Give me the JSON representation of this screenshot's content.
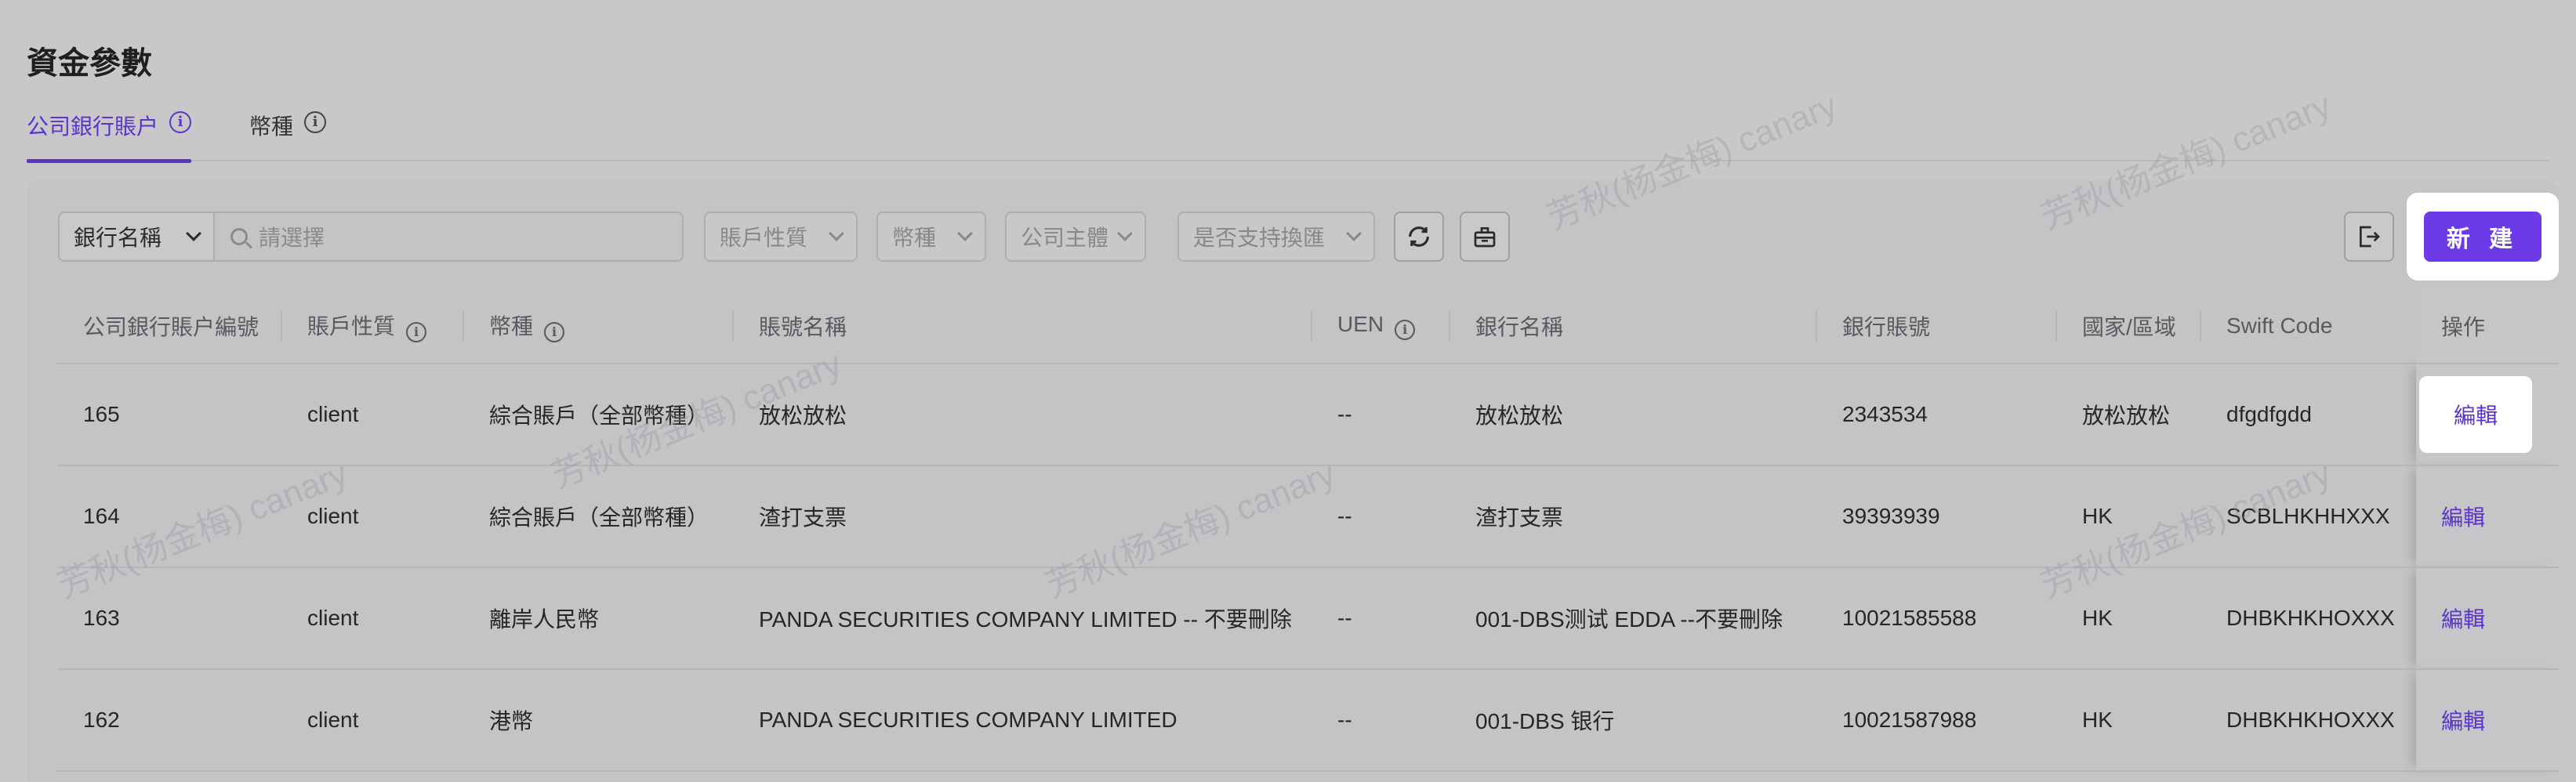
{
  "page": {
    "title": "資金參數"
  },
  "tabs": [
    {
      "label": "公司銀行賬户",
      "active": true
    },
    {
      "label": "幣種",
      "active": false
    }
  ],
  "toolbar": {
    "bank_name_select": "銀行名稱",
    "search_placeholder": "請選擇",
    "account_type_select": "賬戶性質",
    "currency_select": "幣種",
    "entity_select": "公司主體",
    "exchange_select": "是否支持換匯",
    "new_button": "新 建"
  },
  "table": {
    "headers": {
      "id": "公司銀行賬户編號",
      "account_type": "賬戶性質",
      "currency": "幣種",
      "account_name": "賬號名稱",
      "uen": "UEN",
      "bank_name": "銀行名稱",
      "bank_account": "銀行賬號",
      "region": "國家/區域",
      "swift": "Swift Code",
      "action": "操作"
    },
    "rows": [
      {
        "id": "165",
        "account_type": "client",
        "currency": "綜合賬戶（全部幣種）",
        "account_name": "放松放松",
        "uen": "--",
        "bank_name": "放松放松",
        "bank_account": "2343534",
        "region": "放松放松",
        "swift": "dfgdfgdd",
        "action": "編輯"
      },
      {
        "id": "164",
        "account_type": "client",
        "currency": "綜合賬戶（全部幣種）",
        "account_name": "渣打支票",
        "uen": "--",
        "bank_name": "渣打支票",
        "bank_account": "39393939",
        "region": "HK",
        "swift": "SCBLHKHHXXX",
        "action": "編輯"
      },
      {
        "id": "163",
        "account_type": "client",
        "currency": "離岸人民幣",
        "account_name": "PANDA SECURITIES COMPANY LIMITED -- 不要刪除",
        "uen": "--",
        "bank_name": "001-DBS测试 EDDA --不要刪除",
        "bank_account": "10021585588",
        "region": "HK",
        "swift": "DHBKHKHOXXX",
        "action": "編輯"
      },
      {
        "id": "162",
        "account_type": "client",
        "currency": "港幣",
        "account_name": "PANDA SECURITIES COMPANY LIMITED",
        "uen": "--",
        "bank_name": "001-DBS 银行",
        "bank_account": "10021587988",
        "region": "HK",
        "swift": "DHBKHKHOXXX",
        "action": "編輯"
      }
    ]
  },
  "colors": {
    "accent": "#5b35c9",
    "button": "#6c3ae6",
    "background": "#c8c8ca"
  }
}
